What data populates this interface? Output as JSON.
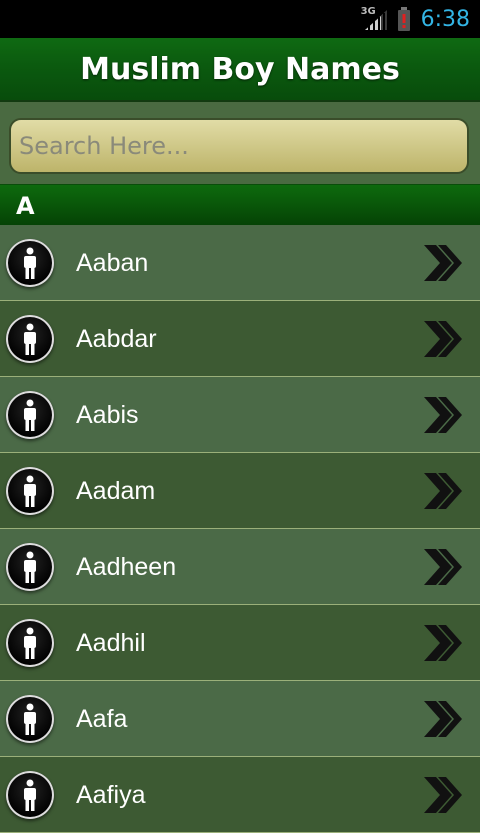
{
  "status_bar": {
    "network": "3G",
    "time": "6:38",
    "icons": [
      "signal-icon",
      "battery-alert-icon"
    ]
  },
  "header": {
    "title": "Muslim Boy Names"
  },
  "search": {
    "placeholder": "Search Here..."
  },
  "section": {
    "letter": "A"
  },
  "names": [
    "Aaban",
    "Aabdar",
    "Aabis",
    "Aadam",
    "Aadheen",
    "Aadhil",
    "Aafa",
    "Aafiya"
  ],
  "colors": {
    "title_bar": "#0b5a0f",
    "row_odd": "#4b6a47",
    "row_even": "#3d5a33",
    "search_bg": "#d8d28f",
    "status_time": "#33b5e5"
  }
}
